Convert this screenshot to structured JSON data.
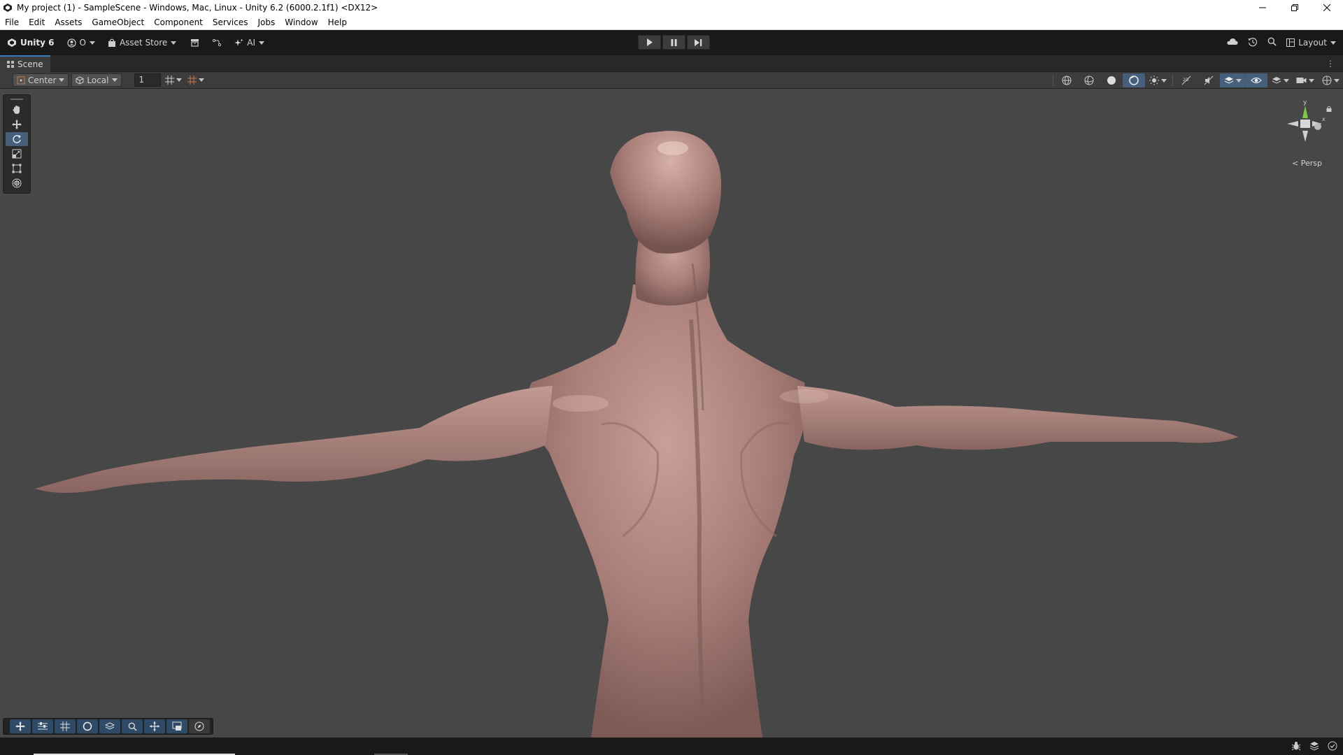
{
  "window": {
    "title": "My project (1) - SampleScene - Windows, Mac, Linux - Unity 6.2 (6000.2.1f1) <DX12>",
    "controls": [
      "minimize",
      "restore",
      "close"
    ]
  },
  "menu": [
    "File",
    "Edit",
    "Assets",
    "GameObject",
    "Component",
    "Services",
    "Jobs",
    "Window",
    "Help"
  ],
  "toolbar": {
    "unity_label": "Unity 6",
    "account_label": "O",
    "asset_store_label": "Asset Store",
    "ai_label": "AI",
    "layout_label": "Layout"
  },
  "scene_tab": {
    "label": "Scene"
  },
  "scene_toolbar": {
    "pivot_mode": "Center",
    "pivot_rotation": "Local",
    "grid_increment": "1"
  },
  "viewport": {
    "projection_label": "Persp",
    "gizmo_axis_y": "y",
    "gizmo_axis_x": "x",
    "background_color": "#474747",
    "active_tool": "rotate",
    "model": "muscular humanoid figure in T-pose, seen from behind"
  },
  "tools": [
    "hand",
    "move",
    "rotate",
    "scale",
    "rect",
    "transform"
  ],
  "overlay_tools": [
    "move-view",
    "orientation",
    "grid",
    "shading",
    "layers",
    "zoom",
    "pan",
    "render-mode",
    "compass"
  ],
  "colors": {
    "accent_blue": "#46607c",
    "tab_highlight": "#3a79bb",
    "skin": "#b58a84",
    "gizmo_y": "#7ec843"
  }
}
